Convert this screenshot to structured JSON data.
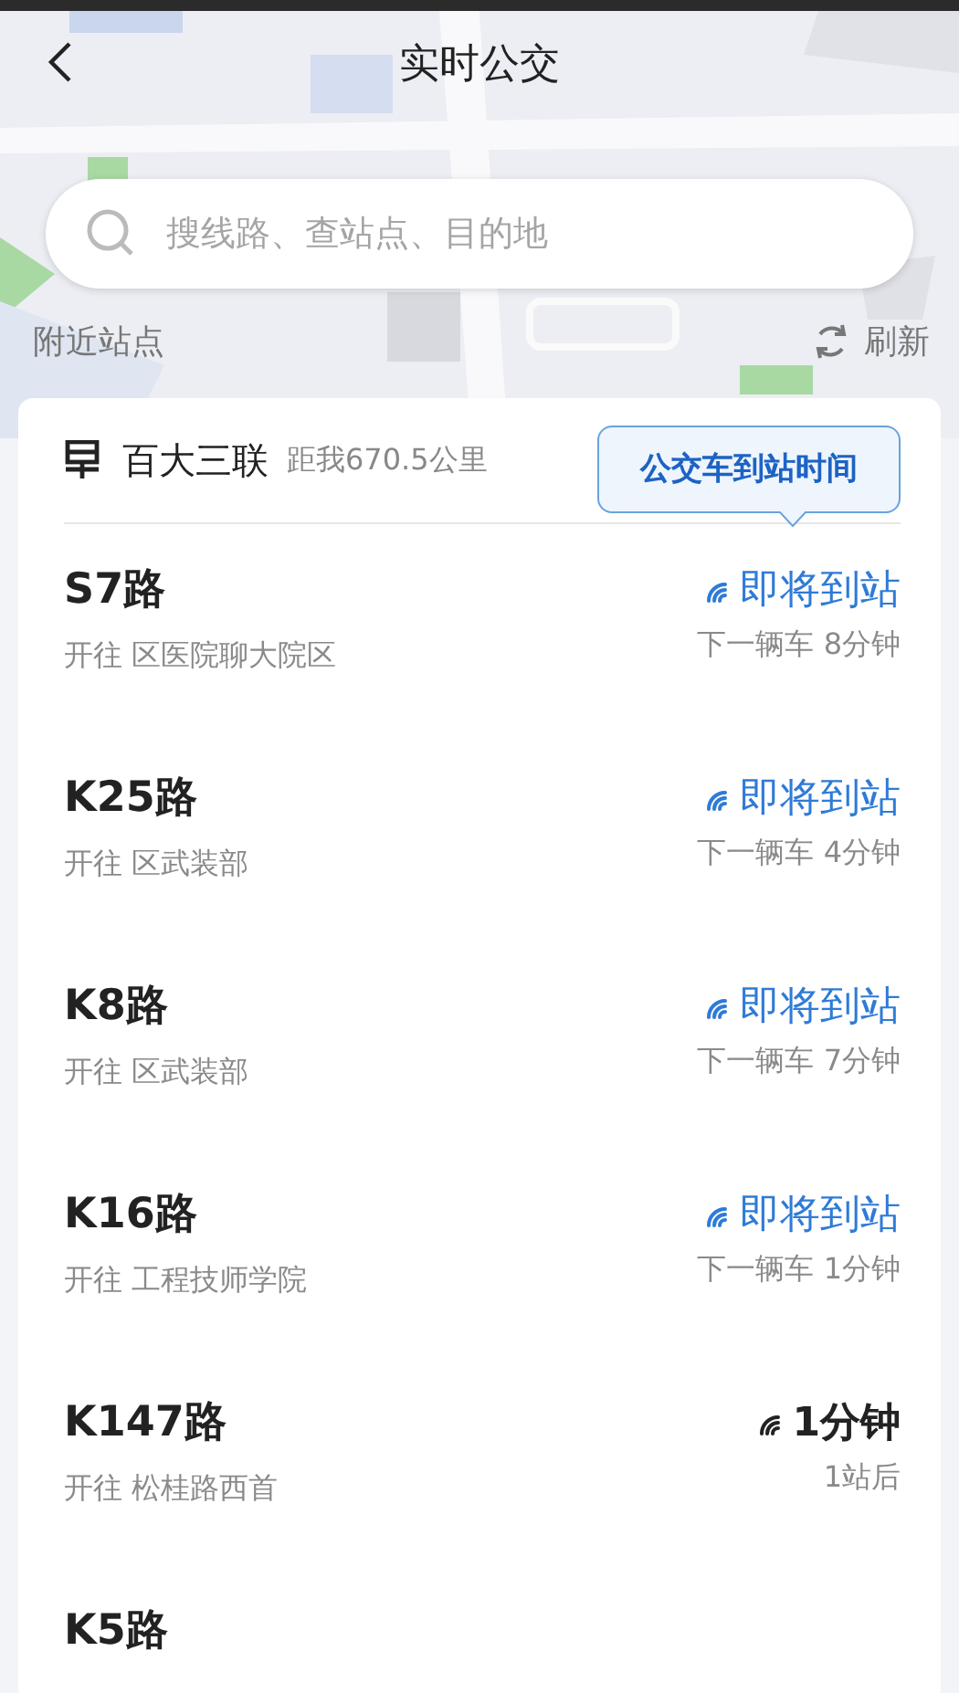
{
  "header": {
    "title": "实时公交"
  },
  "search": {
    "placeholder": "搜线路、查站点、目的地"
  },
  "nearby": {
    "label": "附近站点",
    "refresh": "刷新"
  },
  "stop": {
    "name": "百大三联",
    "distance": "距我670.5公里",
    "tip": "公交车到站时间"
  },
  "routes": [
    {
      "name": "S7路",
      "direction": "开往 区医院聊大院区",
      "kind": "arriving",
      "status": "即将到站",
      "next": "下一辆车 8分钟"
    },
    {
      "name": "K25路",
      "direction": "开往 区武装部",
      "kind": "arriving",
      "status": "即将到站",
      "next": "下一辆车 4分钟"
    },
    {
      "name": "K8路",
      "direction": "开往 区武装部",
      "kind": "arriving",
      "status": "即将到站",
      "next": "下一辆车 7分钟"
    },
    {
      "name": "K16路",
      "direction": "开往 工程技师学院",
      "kind": "arriving",
      "status": "即将到站",
      "next": "下一辆车 1分钟"
    },
    {
      "name": "K147路",
      "direction": "开往 松桂路西首",
      "kind": "minutes",
      "status": "1分钟",
      "next": "1站后"
    },
    {
      "name": "K5路",
      "kind": "partial"
    }
  ]
}
